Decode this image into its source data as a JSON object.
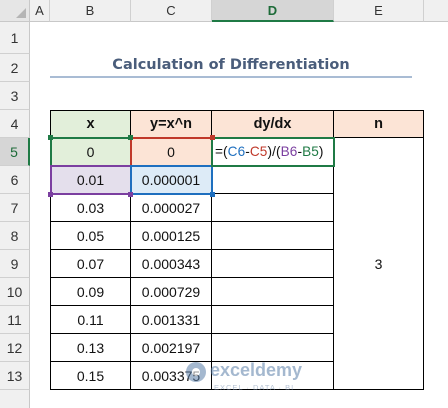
{
  "columns": [
    "A",
    "B",
    "C",
    "D",
    "E"
  ],
  "rows": [
    "1",
    "2",
    "3",
    "4",
    "5",
    "6",
    "7",
    "8",
    "9",
    "10",
    "11",
    "12",
    "13"
  ],
  "title": "Calculation of Differentiation",
  "table": {
    "headers": {
      "x": "x",
      "y": "y=x^n",
      "dydx": "dy/dx",
      "n": "n"
    },
    "x_values": [
      "0",
      "0.01",
      "0.03",
      "0.05",
      "0.07",
      "0.09",
      "0.11",
      "0.13",
      "0.15"
    ],
    "y_values": [
      "0",
      "0.000001",
      "0.000027",
      "0.000125",
      "0.000343",
      "0.000729",
      "0.001331",
      "0.002197",
      "0.003375"
    ],
    "n_value": "3",
    "formula": {
      "p1": "=(",
      "r1": "C6",
      "m1": "-",
      "r2": "C5",
      "p2": ")/(",
      "r3": "B6",
      "m2": "-",
      "r4": "B5",
      "p3": ")"
    }
  },
  "watermark": {
    "name": "exceldemy",
    "tagline": "EXCEL · DATA · BI"
  },
  "colors": {
    "ref_c6": "#1e6fbf",
    "ref_c5": "#c0392b",
    "ref_b6": "#7b3fa0",
    "ref_b5": "#1f7a45",
    "title_text": "#4a5d7b"
  }
}
